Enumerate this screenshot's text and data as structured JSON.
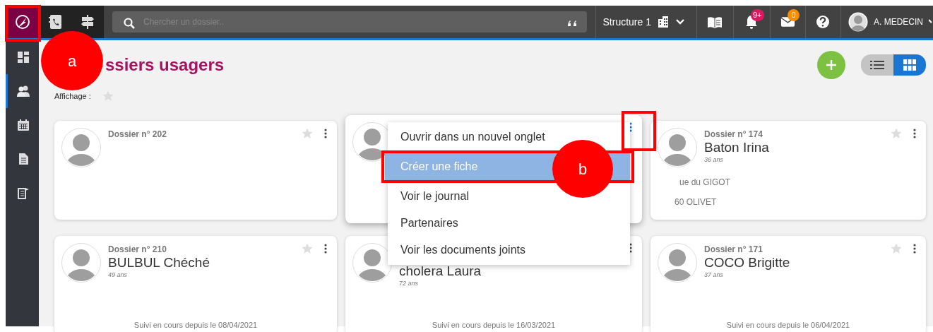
{
  "navbar": {
    "search": {
      "placeholder": "Chercher un dossier.."
    },
    "structure": "Structure 1",
    "notifications_badge": "9+",
    "messages_badge": "0",
    "user": "A. MEDECIN"
  },
  "sidebar": {
    "items": [
      {
        "kind": "dashboard",
        "selected": false
      },
      {
        "kind": "users",
        "selected": true
      },
      {
        "kind": "calendar",
        "selected": false
      },
      {
        "kind": "document",
        "selected": false
      },
      {
        "kind": "export",
        "selected": false
      }
    ]
  },
  "page": {
    "title": "ssiers usagers",
    "display_label": "Affichage :",
    "views": [
      {
        "kind": "list",
        "selected": false
      },
      {
        "kind": "grid",
        "selected": true
      }
    ]
  },
  "cards": [
    {
      "dossier": "Dossier n° 202",
      "favorite": false,
      "menu_open": false
    },
    {
      "menu_open": true
    },
    {
      "dossier": "Dossier n° 174",
      "name": "Baton Irina",
      "age": "36 ans",
      "address": [
        "ue du GIGOT",
        "60 OLIVET"
      ],
      "favorite": false,
      "menu_open": false
    },
    {
      "dossier": "Dossier n° 210",
      "name": "BULBUL Chéché",
      "age": "49 ans",
      "followup": "Suivi en cours depuis le 08/04/2021",
      "favorite": false,
      "menu_open": false
    },
    {
      "name": "cholera Laura",
      "age": "72 ans",
      "followup": "Suivi en cours depuis le 16/03/2021",
      "menu_open": false
    },
    {
      "dossier": "Dossier n° 171",
      "name": "COCO Brigitte",
      "age": "37 ans",
      "followup": "Suivi en cours depuis le 06/04/2021",
      "favorite": false,
      "menu_open": false
    }
  ],
  "context_menu": {
    "items": [
      {
        "label": "Ouvrir dans un nouvel onglet",
        "selected": false
      },
      {
        "label": "Créer une fiche",
        "selected": true
      },
      {
        "label": "Voir le journal",
        "selected": false
      },
      {
        "label": "Partenaires",
        "selected": false
      },
      {
        "label": "Voir les documents joints",
        "selected": false
      }
    ]
  },
  "annotations": [
    {
      "label": "a"
    },
    {
      "label": "b"
    }
  ]
}
